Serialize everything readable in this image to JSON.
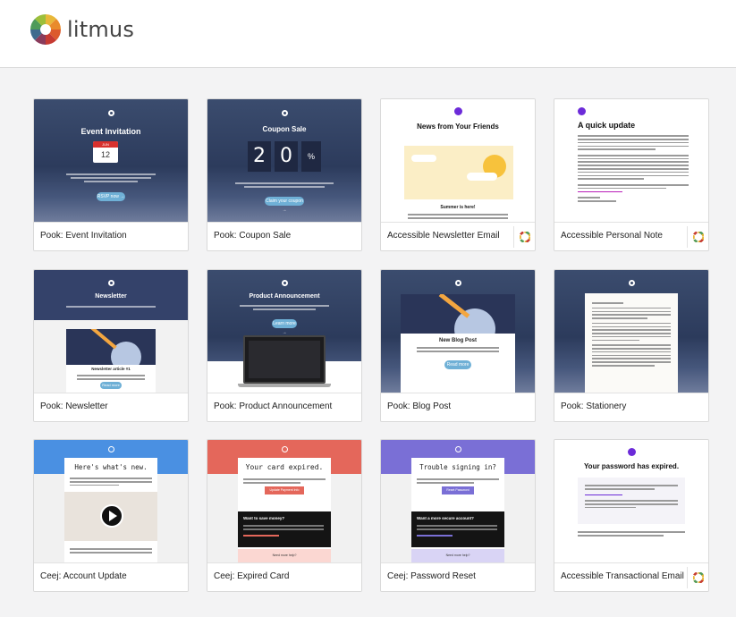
{
  "app": {
    "name": "litmus"
  },
  "templates": [
    {
      "label": "Pook: Event Invitation",
      "thumb": {
        "title": "Event Invitation",
        "calendar_month": "JUN",
        "calendar_day": "12",
        "button": "RSVP now →"
      }
    },
    {
      "label": "Pook: Coupon Sale",
      "thumb": {
        "title": "Coupon Sale",
        "digit1": "2",
        "digit2": "0",
        "percent": "%",
        "button": "Claim your coupon →"
      }
    },
    {
      "label": "Accessible Newsletter Email",
      "badge": "litmus-icon",
      "thumb": {
        "title": "News from Your Friends",
        "subtitle": "Summer is here!"
      }
    },
    {
      "label": "Accessible Personal Note",
      "badge": "litmus-icon",
      "thumb": {
        "title": "A quick update"
      }
    },
    {
      "label": "Pook: Newsletter",
      "thumb": {
        "title": "Newsletter",
        "article": "Newsletter article #1",
        "button": "Read more →"
      }
    },
    {
      "label": "Pook: Product Announcement",
      "thumb": {
        "title": "Product Announcement",
        "button": "Learn more →"
      }
    },
    {
      "label": "Pook: Blog Post",
      "thumb": {
        "title": "New Blog Post",
        "button": "Read more →"
      }
    },
    {
      "label": "Pook: Stationery",
      "thumb": {}
    },
    {
      "label": "Ceej: Account Update",
      "thumb": {
        "title": "Here's what's new."
      }
    },
    {
      "label": "Ceej: Expired Card",
      "thumb": {
        "title": "Your card expired.",
        "button": "Update Payment Info",
        "section": "Want to save money?",
        "help": "Need more help?"
      }
    },
    {
      "label": "Ceej: Password Reset",
      "thumb": {
        "title": "Trouble signing in?",
        "button": "Reset Password",
        "section": "Want a more secure account?",
        "help": "Need more help?"
      }
    },
    {
      "label": "Accessible Transactional Email",
      "badge": "litmus-icon",
      "thumb": {
        "title": "Your password has expired."
      }
    }
  ]
}
